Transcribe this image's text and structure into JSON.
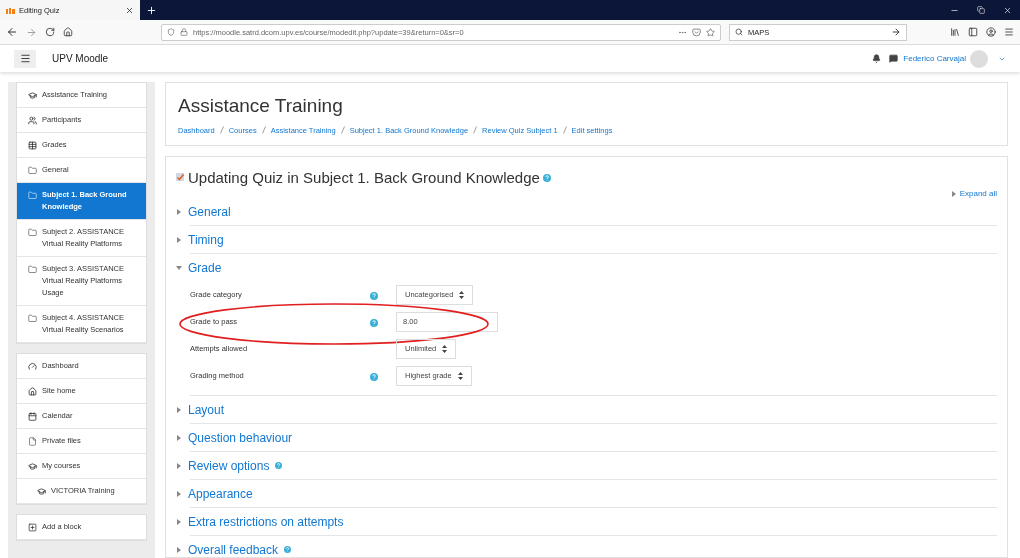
{
  "browser": {
    "tab_title": "Editing Quiz",
    "url": "https://moodle.satrd.dcom.upv.es/course/modedit.php?update=39&return=0&sr=0",
    "search_value": "MAPS"
  },
  "navbar": {
    "site_name": "UPV Moodle",
    "user_name": "Federico Carvajal"
  },
  "sidebar": {
    "course_nav": [
      {
        "label": "Assistance Training",
        "kind": "course",
        "selected": false
      },
      {
        "label": "Participants",
        "kind": "people",
        "selected": false
      },
      {
        "label": "Grades",
        "kind": "table",
        "selected": false
      },
      {
        "label": "General",
        "kind": "folder",
        "selected": false
      },
      {
        "label": "Subject 1. Back Ground Knowledge",
        "kind": "folder",
        "selected": true
      },
      {
        "label": "Subject 2. ASSISTANCE Virtual Reality Platforms",
        "kind": "folder",
        "selected": false
      },
      {
        "label": "Subject 3. ASSISTANCE Virtual Reality Platforms Usage",
        "kind": "folder",
        "selected": false
      },
      {
        "label": "Subject 4. ASSISTANCE Virtual Reality Scenarios",
        "kind": "folder",
        "selected": false
      }
    ],
    "site_nav": [
      {
        "label": "Dashboard",
        "kind": "dashboard"
      },
      {
        "label": "Site home",
        "kind": "home"
      },
      {
        "label": "Calendar",
        "kind": "calendar"
      },
      {
        "label": "Private files",
        "kind": "file"
      },
      {
        "label": "My courses",
        "kind": "course",
        "children": [
          {
            "label": "VICTORIA Training",
            "kind": "course"
          }
        ]
      }
    ],
    "add_block": "Add a block"
  },
  "header": {
    "title": "Assistance Training",
    "breadcrumbs": [
      "Dashboard",
      "Courses",
      "Assistance Training",
      "Subject 1. Back Ground Knowledge",
      "Review Quiz Subject 1",
      "Edit settings"
    ]
  },
  "form": {
    "heading": "Updating Quiz in Subject 1. Back Ground Knowledge",
    "expand_all": "Expand all",
    "sections": [
      {
        "title": "General",
        "expanded": false,
        "help": false
      },
      {
        "title": "Timing",
        "expanded": false,
        "help": false
      },
      {
        "title": "Grade",
        "expanded": true,
        "help": false,
        "fields": [
          {
            "label": "Grade category",
            "help": true,
            "kind": "select",
            "value": "Uncategorised",
            "highlighted": false
          },
          {
            "label": "Grade to pass",
            "help": true,
            "kind": "text",
            "value": "8.00",
            "highlighted": true
          },
          {
            "label": "Attempts allowed",
            "help": false,
            "kind": "select",
            "value": "Unlimited",
            "highlighted": false
          },
          {
            "label": "Grading method",
            "help": true,
            "kind": "select",
            "value": "Highest grade",
            "highlighted": false
          }
        ]
      },
      {
        "title": "Layout",
        "expanded": false,
        "help": false
      },
      {
        "title": "Question behaviour",
        "expanded": false,
        "help": false
      },
      {
        "title": "Review options",
        "expanded": false,
        "help": true
      },
      {
        "title": "Appearance",
        "expanded": false,
        "help": false
      },
      {
        "title": "Extra restrictions on attempts",
        "expanded": false,
        "help": false
      },
      {
        "title": "Overall feedback",
        "expanded": false,
        "help": true
      }
    ]
  }
}
